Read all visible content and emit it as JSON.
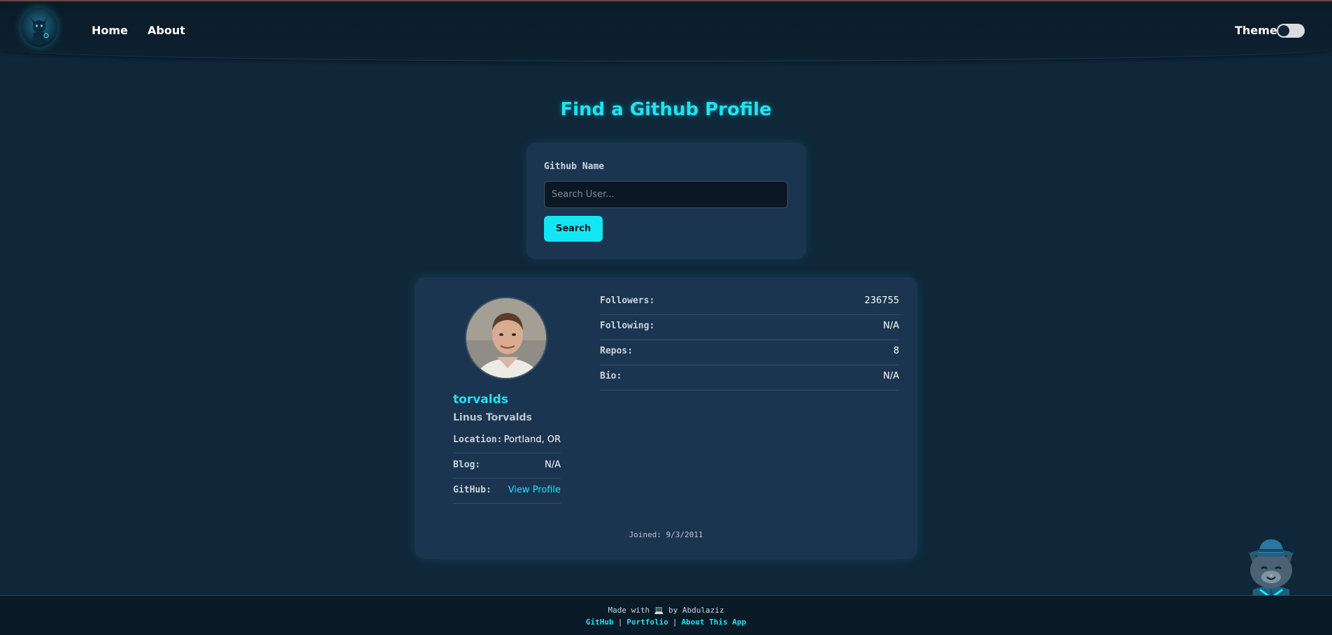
{
  "nav": {
    "links": [
      "Home",
      "About"
    ],
    "theme_label": "Theme"
  },
  "search": {
    "title": "Find a Github Profile",
    "field_label": "Github Name",
    "placeholder": "Search User...",
    "button_label": "Search"
  },
  "profile": {
    "username": "torvalds",
    "name": "Linus Torvalds",
    "details": [
      {
        "key": "Location:",
        "value": "Portland, OR"
      },
      {
        "key": "Blog:",
        "value": "N/A"
      },
      {
        "key": "GitHub:",
        "value": "View Profile"
      }
    ],
    "stats": [
      {
        "key": "Followers:",
        "value": "236755"
      },
      {
        "key": "Following:",
        "value": "N/A"
      },
      {
        "key": "Repos:",
        "value": "8"
      },
      {
        "key": "Bio:",
        "value": "N/A"
      }
    ],
    "joined": "Joined: 9/3/2011"
  },
  "footer": {
    "made_with": "Made with 💻 by Abdulaziz",
    "links": [
      "GitHub",
      "Portfolio",
      "About This App"
    ]
  },
  "colors": {
    "accent": "#1fe3f2",
    "background": "#0f2739",
    "card": "#1b3550"
  }
}
